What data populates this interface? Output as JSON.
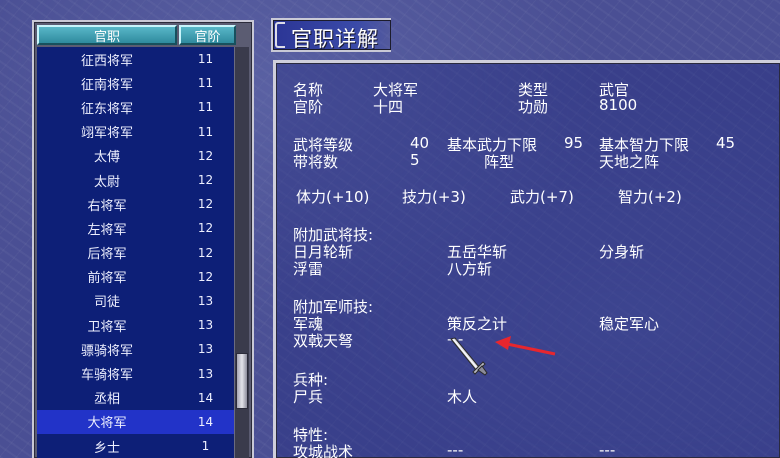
{
  "list": {
    "header_name": "官职",
    "header_rank": "官阶",
    "rows": [
      {
        "name": "征西将军",
        "rank": "11"
      },
      {
        "name": "征南将军",
        "rank": "11"
      },
      {
        "name": "征东将军",
        "rank": "11"
      },
      {
        "name": "翊军将军",
        "rank": "11"
      },
      {
        "name": "太傅",
        "rank": "12"
      },
      {
        "name": "太尉",
        "rank": "12"
      },
      {
        "name": "右将军",
        "rank": "12"
      },
      {
        "name": "左将军",
        "rank": "12"
      },
      {
        "name": "后将军",
        "rank": "12"
      },
      {
        "name": "前将军",
        "rank": "12"
      },
      {
        "name": "司徒",
        "rank": "13"
      },
      {
        "name": "卫将军",
        "rank": "13"
      },
      {
        "name": "骠骑将军",
        "rank": "13"
      },
      {
        "name": "车骑将军",
        "rank": "13"
      },
      {
        "name": "丞相",
        "rank": "14"
      },
      {
        "name": "大将军",
        "rank": "14"
      },
      {
        "name": "乡士",
        "rank": "1"
      }
    ],
    "selected_index": 15
  },
  "detail": {
    "title": "官职详解",
    "name_label": "名称",
    "name_value": "大将军",
    "type_label": "类型",
    "type_value": "武官",
    "rank_label": "官阶",
    "rank_value": "十四",
    "merit_label": "功勋",
    "merit_value": "8100",
    "level_label": "武将等级",
    "level_value": "40",
    "min_force_label": "基本武力下限",
    "min_force_value": "95",
    "min_int_label": "基本智力下限",
    "min_int_value": "45",
    "troops_label": "带将数",
    "troops_value": "5",
    "formation_label": "阵型",
    "formation_value": "天地之阵",
    "bonus_hp": "体力(+10)",
    "bonus_skill": "技力(+3)",
    "bonus_force": "武力(+7)",
    "bonus_int": "智力(+2)",
    "general_skills_label": "附加武将技:",
    "general_skills": [
      "日月轮斩",
      "五岳华斩",
      "分身斩",
      "浮雷",
      "八方斩"
    ],
    "strategist_skills_label": "附加军师技:",
    "strategist_skills": [
      "军魂",
      "策反之计",
      "稳定军心",
      "双戟天弩",
      "---"
    ],
    "unit_label": "兵种:",
    "units": [
      "尸兵",
      "木人"
    ],
    "traits_label": "特性:",
    "traits": [
      "攻城战术",
      "---",
      "---"
    ]
  },
  "colors": {
    "list_bg": "#0d1f77",
    "selected_row": "#2233c8",
    "header_teal": "#3a9cb0",
    "arrow_red": "#e8262e"
  }
}
